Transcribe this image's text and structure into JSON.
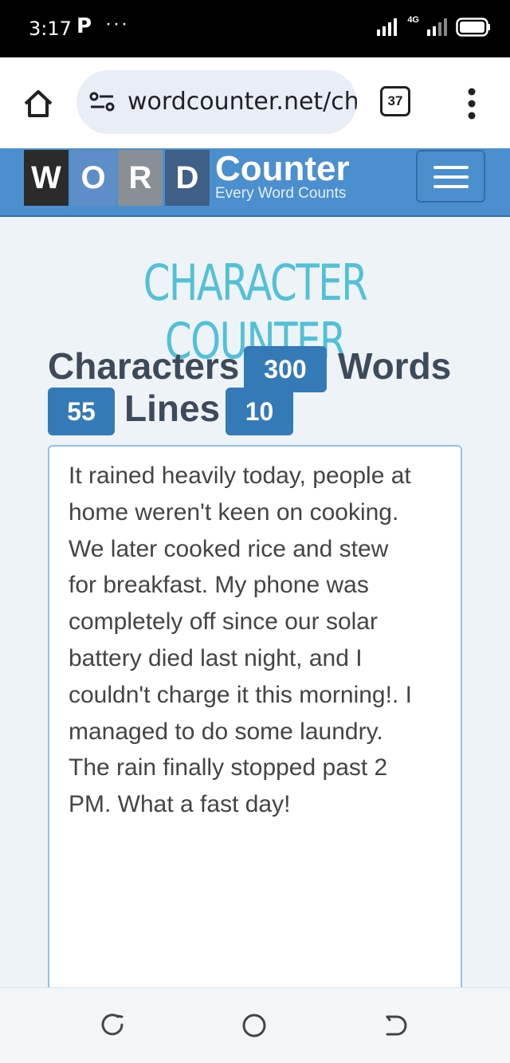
{
  "status_bar": {
    "time": "3:17",
    "carrier_icon": "P",
    "overflow": "···",
    "network_label": "4G"
  },
  "browser": {
    "url": "wordcounter.net/ch",
    "tab_count": "37"
  },
  "header": {
    "logo_letters": [
      "W",
      "O",
      "R",
      "D"
    ],
    "logo_word": "Counter",
    "tagline": "Every Word Counts"
  },
  "page": {
    "title": "CHARACTER COUNTER"
  },
  "stats": {
    "characters_label": "Characters",
    "characters_value": "300",
    "words_label": "Words",
    "words_value": "55",
    "lines_label": "Lines",
    "lines_value": "10"
  },
  "editor": {
    "lines": [
      "It rained heavily today, people at",
      "home weren't keen on cooking.",
      "We later cooked rice and stew",
      "for breakfast. My phone was",
      "completely off since our solar",
      "battery died last night, and I",
      "couldn't charge it this morning!. I",
      "managed to do some laundry.",
      "The rain finally stopped past 2",
      "PM. What a fast day!"
    ]
  },
  "colors": {
    "header_blue": "#4b8fcf",
    "badge_blue": "#337ab7",
    "title_cyan": "#54c0d8"
  }
}
